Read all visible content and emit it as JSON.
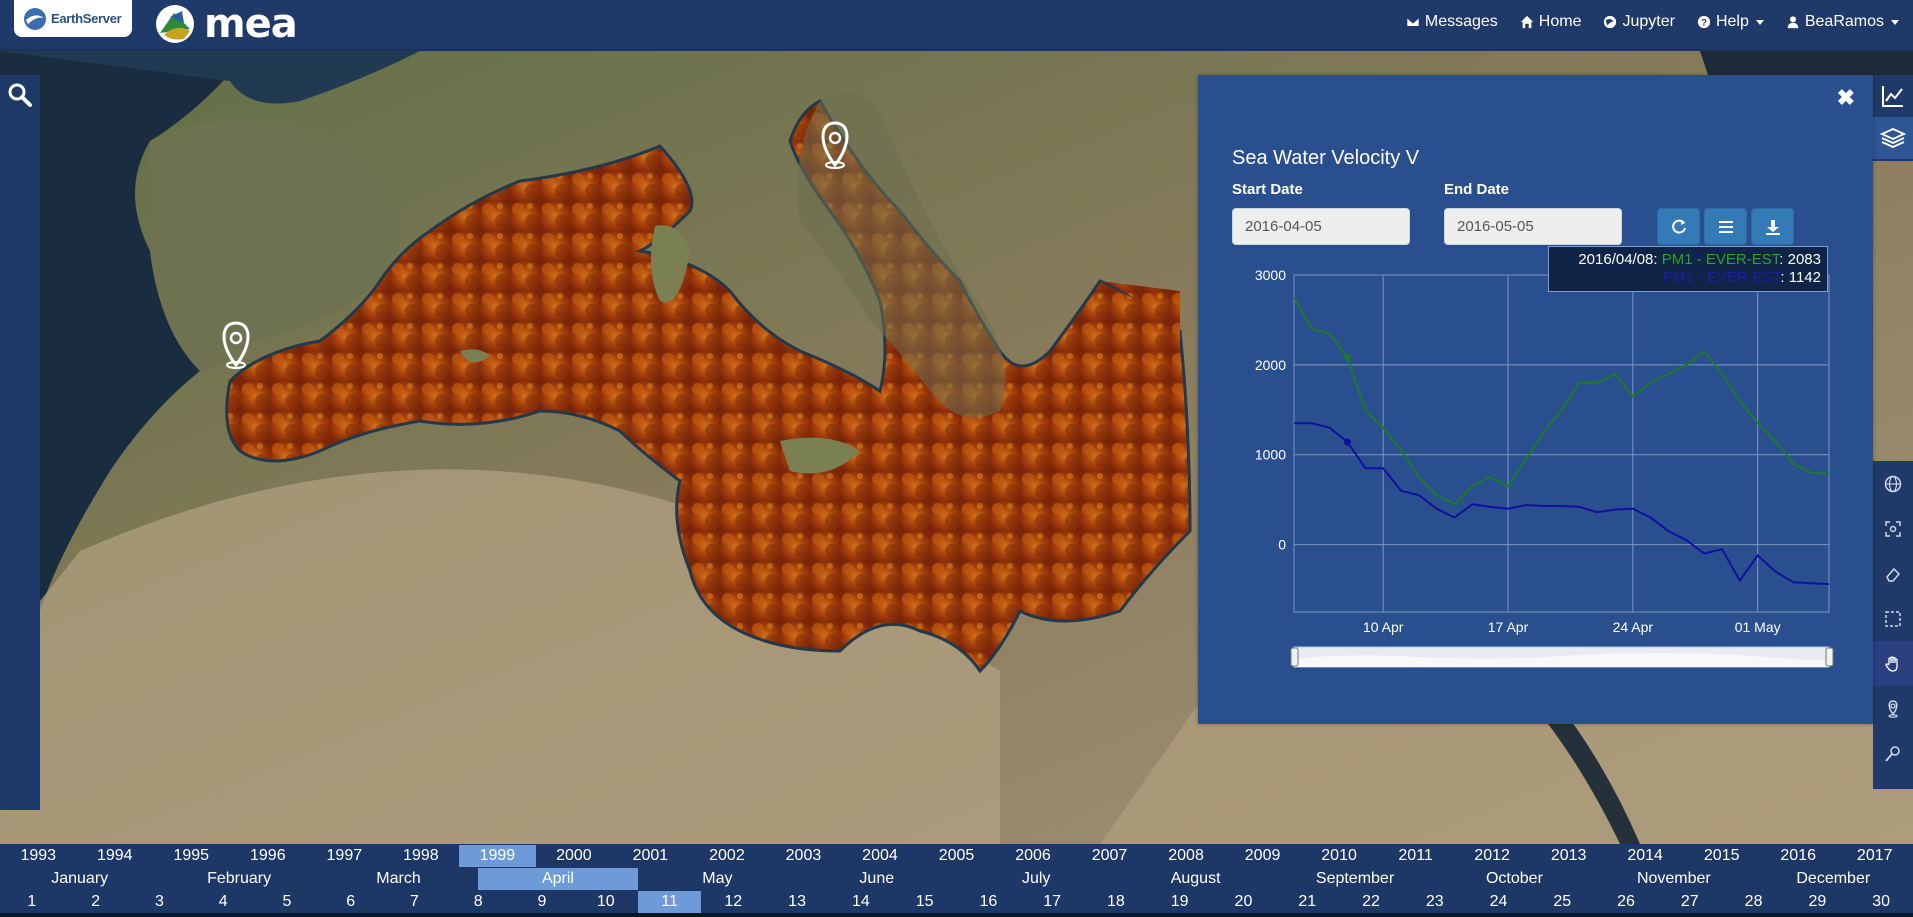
{
  "navbar": {
    "brand_left": "EarthServer",
    "brand_main": "mea",
    "items": [
      {
        "label": "Messages",
        "icon": "envelope-icon"
      },
      {
        "label": "Home",
        "icon": "home-icon"
      },
      {
        "label": "Jupyter",
        "icon": "globe-icon"
      },
      {
        "label": "Help",
        "icon": "question-icon",
        "dropdown": true
      },
      {
        "label": "BeaRamos",
        "icon": "user-icon",
        "dropdown": true
      }
    ]
  },
  "panel": {
    "title": "Sea Water Velocity V",
    "start_label": "Start Date",
    "end_label": "End Date",
    "start_value": "2016-04-05",
    "end_value": "2016-05-05",
    "tooltip": {
      "date": "2016/04/08",
      "series1_name": "PM1 - EVER-EST",
      "series1_value": "2083",
      "series2_name": "PM1 - EVER-EST",
      "series2_value": "1142"
    }
  },
  "chart_data": {
    "type": "line",
    "x_ticks": [
      "10 Apr",
      "17 Apr",
      "24 Apr",
      "01 May"
    ],
    "y_ticks": [
      "3000",
      "2000",
      "1000",
      "0"
    ],
    "ylim": [
      -750,
      3000
    ],
    "xlim": [
      "2016-04-05",
      "2016-05-05"
    ],
    "grid": true,
    "series": [
      {
        "name": "PM1 - EVER-EST",
        "color": "#1c7a2b",
        "x": [
          "2016-04-05",
          "2016-04-06",
          "2016-04-07",
          "2016-04-08",
          "2016-04-09",
          "2016-04-10",
          "2016-04-11",
          "2016-04-12",
          "2016-04-13",
          "2016-04-14",
          "2016-04-15",
          "2016-04-16",
          "2016-04-17",
          "2016-04-18",
          "2016-04-19",
          "2016-04-20",
          "2016-04-21",
          "2016-04-22",
          "2016-04-23",
          "2016-04-24",
          "2016-04-25",
          "2016-04-26",
          "2016-04-27",
          "2016-04-28",
          "2016-04-29",
          "2016-04-30",
          "2016-05-01",
          "2016-05-02",
          "2016-05-03",
          "2016-05-04",
          "2016-05-05"
        ],
        "values": [
          2750,
          2400,
          2350,
          2083,
          1500,
          1300,
          1050,
          750,
          550,
          450,
          650,
          750,
          650,
          950,
          1250,
          1500,
          1800,
          1800,
          1900,
          1650,
          1800,
          1900,
          2000,
          2150,
          1900,
          1600,
          1350,
          1150,
          900,
          800,
          790
        ]
      },
      {
        "name": "PM1 - EVER-EST",
        "color": "#1010a0",
        "x": [
          "2016-04-05",
          "2016-04-06",
          "2016-04-07",
          "2016-04-08",
          "2016-04-09",
          "2016-04-10",
          "2016-04-11",
          "2016-04-12",
          "2016-04-13",
          "2016-04-14",
          "2016-04-15",
          "2016-04-16",
          "2016-04-17",
          "2016-04-18",
          "2016-04-19",
          "2016-04-20",
          "2016-04-21",
          "2016-04-22",
          "2016-04-23",
          "2016-04-24",
          "2016-04-25",
          "2016-04-26",
          "2016-04-27",
          "2016-04-28",
          "2016-04-29",
          "2016-04-30",
          "2016-05-01",
          "2016-05-02",
          "2016-05-03",
          "2016-05-04",
          "2016-05-05"
        ],
        "values": [
          1350,
          1350,
          1300,
          1142,
          850,
          850,
          600,
          550,
          400,
          300,
          450,
          420,
          400,
          440,
          430,
          430,
          420,
          360,
          390,
          400,
          300,
          150,
          50,
          -100,
          -50,
          -400,
          -120,
          -300,
          -420,
          -430,
          -440
        ]
      }
    ]
  },
  "timeline": {
    "years": [
      "1993",
      "1994",
      "1995",
      "1996",
      "1997",
      "1998",
      "1999",
      "2000",
      "2001",
      "2002",
      "2003",
      "2004",
      "2005",
      "2006",
      "2007",
      "2008",
      "2009",
      "2010",
      "2011",
      "2012",
      "2013",
      "2014",
      "2015",
      "2016",
      "2017"
    ],
    "selected_year": "1999",
    "months": [
      "January",
      "February",
      "March",
      "April",
      "May",
      "June",
      "July",
      "August",
      "September",
      "October",
      "November",
      "December"
    ],
    "selected_month": "April",
    "days": [
      "1",
      "2",
      "3",
      "4",
      "5",
      "6",
      "7",
      "8",
      "9",
      "10",
      "11",
      "12",
      "13",
      "14",
      "15",
      "16",
      "17",
      "18",
      "19",
      "20",
      "21",
      "22",
      "23",
      "24",
      "25",
      "26",
      "27",
      "28",
      "29",
      "30"
    ],
    "selected_day": "11"
  }
}
